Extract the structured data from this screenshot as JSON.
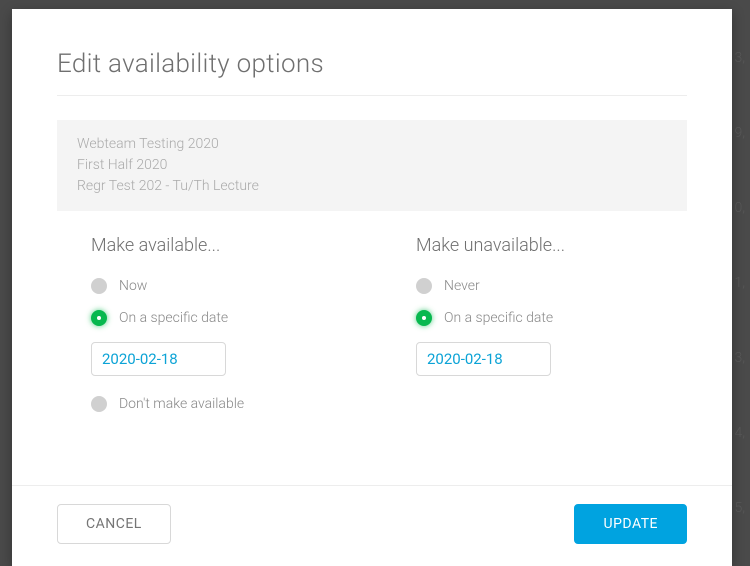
{
  "dialog": {
    "title": "Edit availability options",
    "context": {
      "line1": "Webteam Testing 2020",
      "line2": "First Half 2020",
      "line3": "Regr Test 202 - Tu/Th Lecture"
    },
    "available": {
      "heading": "Make available...",
      "options": {
        "now": "Now",
        "specific": "On a specific date",
        "dont": "Don't make available"
      },
      "date_value": "2020-02-18"
    },
    "unavailable": {
      "heading": "Make unavailable...",
      "options": {
        "never": "Never",
        "specific": "On a specific date"
      },
      "date_value": "2020-02-18"
    },
    "buttons": {
      "cancel": "CANCEL",
      "update": "UPDATE"
    }
  },
  "background_hints": [
    "3,",
    "9,",
    "0,",
    "1,",
    "3,",
    "4,",
    "5,"
  ]
}
